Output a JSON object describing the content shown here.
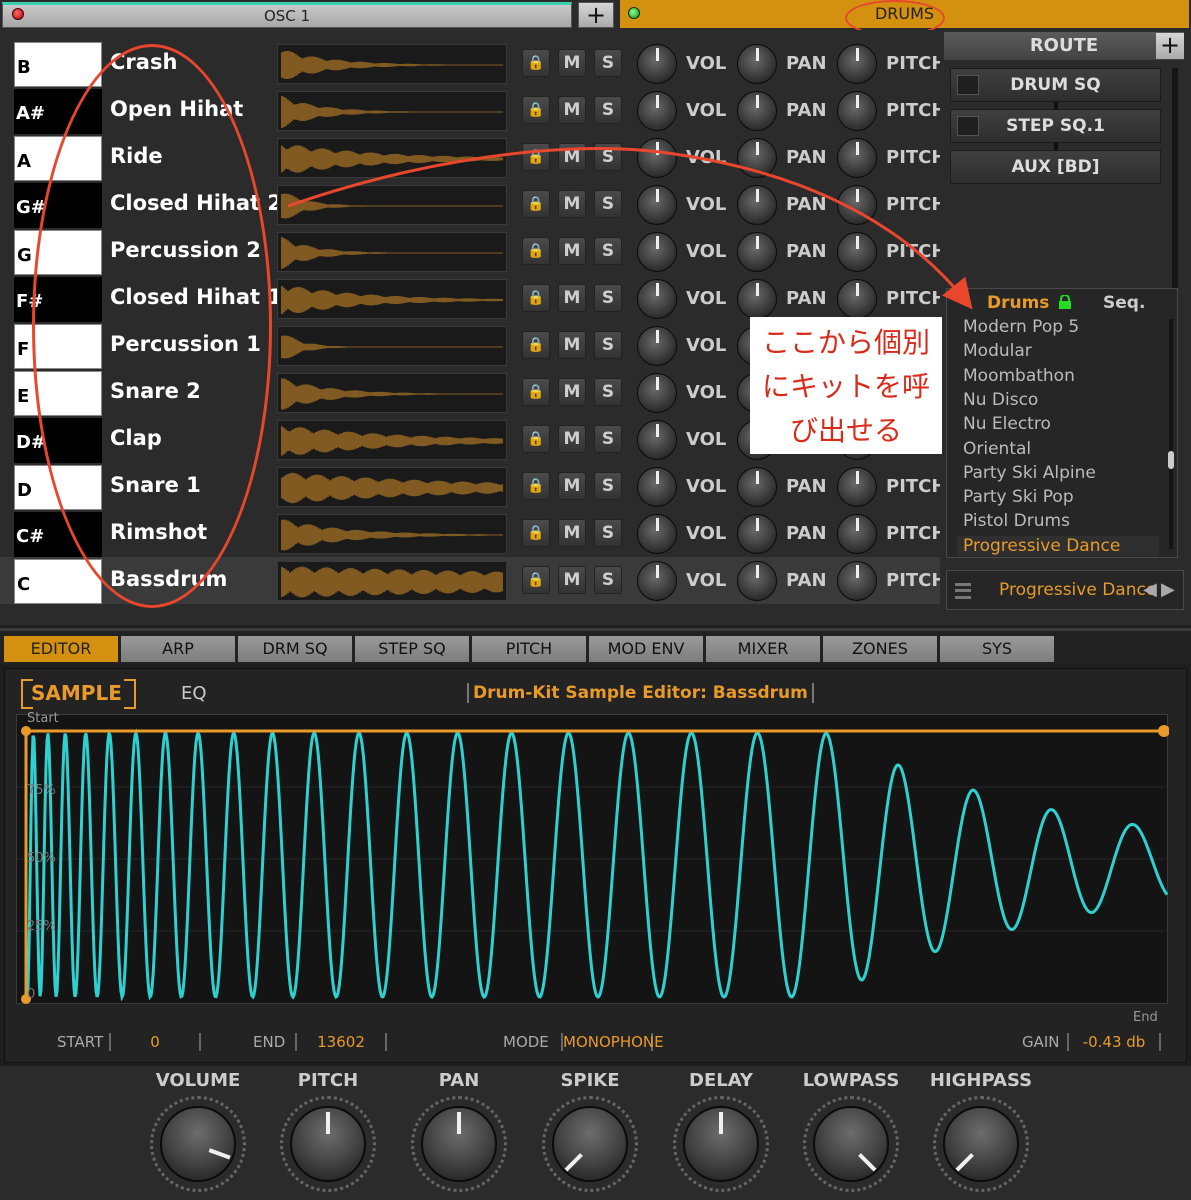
{
  "topbar": {
    "osc_tab": "OSC 1",
    "add_label": "+",
    "drums_tab": "DRUMS"
  },
  "drum_rows": [
    {
      "key": "B",
      "color": "white",
      "name": "Crash"
    },
    {
      "key": "A#",
      "color": "black",
      "name": "Open Hihat"
    },
    {
      "key": "A",
      "color": "white",
      "name": "Ride"
    },
    {
      "key": "G#",
      "color": "black",
      "name": "Closed Hihat 2"
    },
    {
      "key": "G",
      "color": "white",
      "name": "Percussion 2"
    },
    {
      "key": "F#",
      "color": "black",
      "name": "Closed Hihat 1"
    },
    {
      "key": "F",
      "color": "white",
      "name": "Percussion 1"
    },
    {
      "key": "E",
      "color": "white",
      "name": "Snare 2"
    },
    {
      "key": "D#",
      "color": "black",
      "name": "Clap"
    },
    {
      "key": "D",
      "color": "white",
      "name": "Snare 1"
    },
    {
      "key": "C#",
      "color": "black",
      "name": "Rimshot"
    },
    {
      "key": "C",
      "color": "white",
      "name": "Bassdrum"
    }
  ],
  "row_buttons": {
    "mute": "M",
    "solo": "S",
    "vol": "VOL",
    "pan": "PAN",
    "pitch": "PITCH"
  },
  "route": {
    "title": "ROUTE",
    "add": "+",
    "items": [
      "DRUM SQ",
      "STEP SQ.1",
      "AUX [BD]"
    ]
  },
  "presets": {
    "tab_drums": "Drums",
    "tab_seq": "Seq.",
    "items": [
      "Modern Pop 5",
      "Modular",
      "Moombathon",
      "Nu Disco",
      "Nu Electro",
      "Oriental",
      "Party Ski Alpine",
      "Party Ski Pop",
      "Pistol Drums",
      "Progressive Dance"
    ],
    "current": "Progressive Dance",
    "prev": "◀",
    "next": "▶"
  },
  "callout": {
    "line1": "ここから個別",
    "line2": "にキットを呼",
    "line3": "び出せる"
  },
  "tabs": [
    "EDITOR",
    "ARP",
    "DRM SQ",
    "STEP SQ",
    "PITCH",
    "MOD ENV",
    "MIXER",
    "ZONES",
    "SYS"
  ],
  "editor": {
    "sample_tab": "SAMPLE",
    "eq_tab": "EQ",
    "title": "Drum-Kit Sample Editor: Bassdrum",
    "start_marker": "Start",
    "end_marker": "End",
    "grid_labels": [
      "75%",
      "50%",
      "25%",
      "0"
    ],
    "start_label": "START",
    "start_value": "0",
    "end_label": "END",
    "end_value": "13602",
    "mode_label": "MODE",
    "mode_value": "MONOPHONE",
    "gain_label": "GAIN",
    "gain_value": "-0.43 db"
  },
  "bottom_knobs": [
    {
      "label": "VOLUME",
      "angle": 110
    },
    {
      "label": "PITCH",
      "angle": 0
    },
    {
      "label": "PAN",
      "angle": 0
    },
    {
      "label": "SPIKE",
      "angle": -135
    },
    {
      "label": "DELAY",
      "angle": 0
    },
    {
      "label": "LOWPASS",
      "angle": 135
    },
    {
      "label": "HIGHPASS",
      "angle": -135
    }
  ],
  "colors": {
    "accent": "#d4900f",
    "text_orange": "#e89a2a",
    "waveform": "#2fd0d0",
    "annotation": "#e8472e"
  }
}
